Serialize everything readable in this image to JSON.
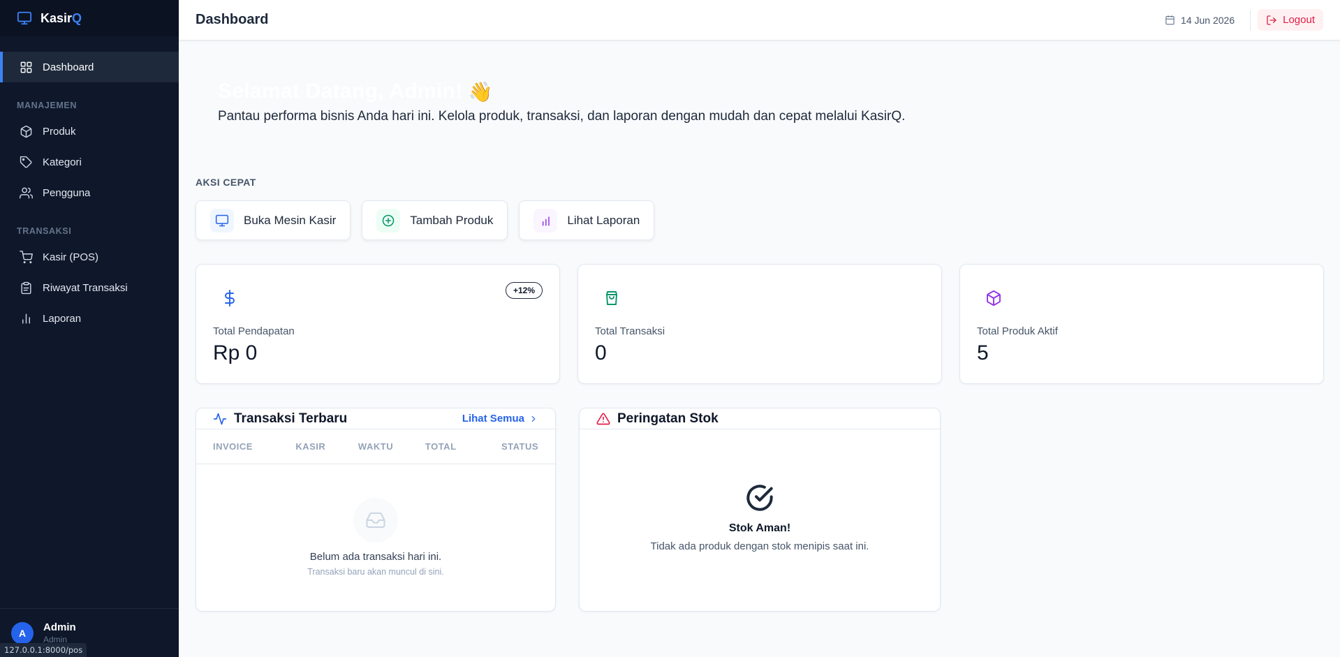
{
  "app": {
    "brand_prefix": "Kasir",
    "brand_suffix": "Q"
  },
  "sidebar": {
    "main_item": "Dashboard",
    "sections": [
      {
        "label": "MANAJEMEN",
        "items": [
          "Produk",
          "Kategori",
          "Pengguna"
        ]
      },
      {
        "label": "TRANSAKSI",
        "items": [
          "Kasir (POS)",
          "Riwayat Transaksi",
          "Laporan"
        ]
      }
    ],
    "user": {
      "initial": "A",
      "name": "Admin",
      "role": "Admin"
    }
  },
  "status_bar_url": "127.0.0.1:8000/pos",
  "header": {
    "title": "Dashboard",
    "date": "14 Jun 2026",
    "logout_label": "Logout"
  },
  "hero": {
    "title": "Selamat Datang, Admin!",
    "wave": "👋",
    "subtitle": "Pantau performa bisnis Anda hari ini. Kelola produk, transaksi, dan laporan dengan mudah dan cepat melalui KasirQ."
  },
  "quick_actions": {
    "label": "AKSI CEPAT",
    "items": [
      "Buka Mesin Kasir",
      "Tambah Produk",
      "Lihat Laporan"
    ]
  },
  "stats": [
    {
      "label": "Total Pendapatan",
      "value": "Rp 0",
      "badge": "+12%"
    },
    {
      "label": "Total Transaksi",
      "value": "0"
    },
    {
      "label": "Total Produk Aktif",
      "value": "5"
    }
  ],
  "recent_transactions": {
    "title": "Transaksi Terbaru",
    "see_all": "Lihat Semua",
    "columns": [
      "INVOICE",
      "KASIR",
      "WAKTU",
      "TOTAL",
      "STATUS"
    ],
    "empty_title": "Belum ada transaksi hari ini.",
    "empty_sub": "Transaksi baru akan muncul di sini."
  },
  "stock_warning": {
    "title": "Peringatan Stok",
    "ok_title": "Stok Aman!",
    "ok_sub": "Tidak ada produk dengan stok menipis saat ini."
  },
  "colors": {
    "sidebar_bg": "#0f172a",
    "accent": "#3b82f6",
    "logout": "#e11d48",
    "success": "#059669",
    "purple": "#9333ea"
  }
}
